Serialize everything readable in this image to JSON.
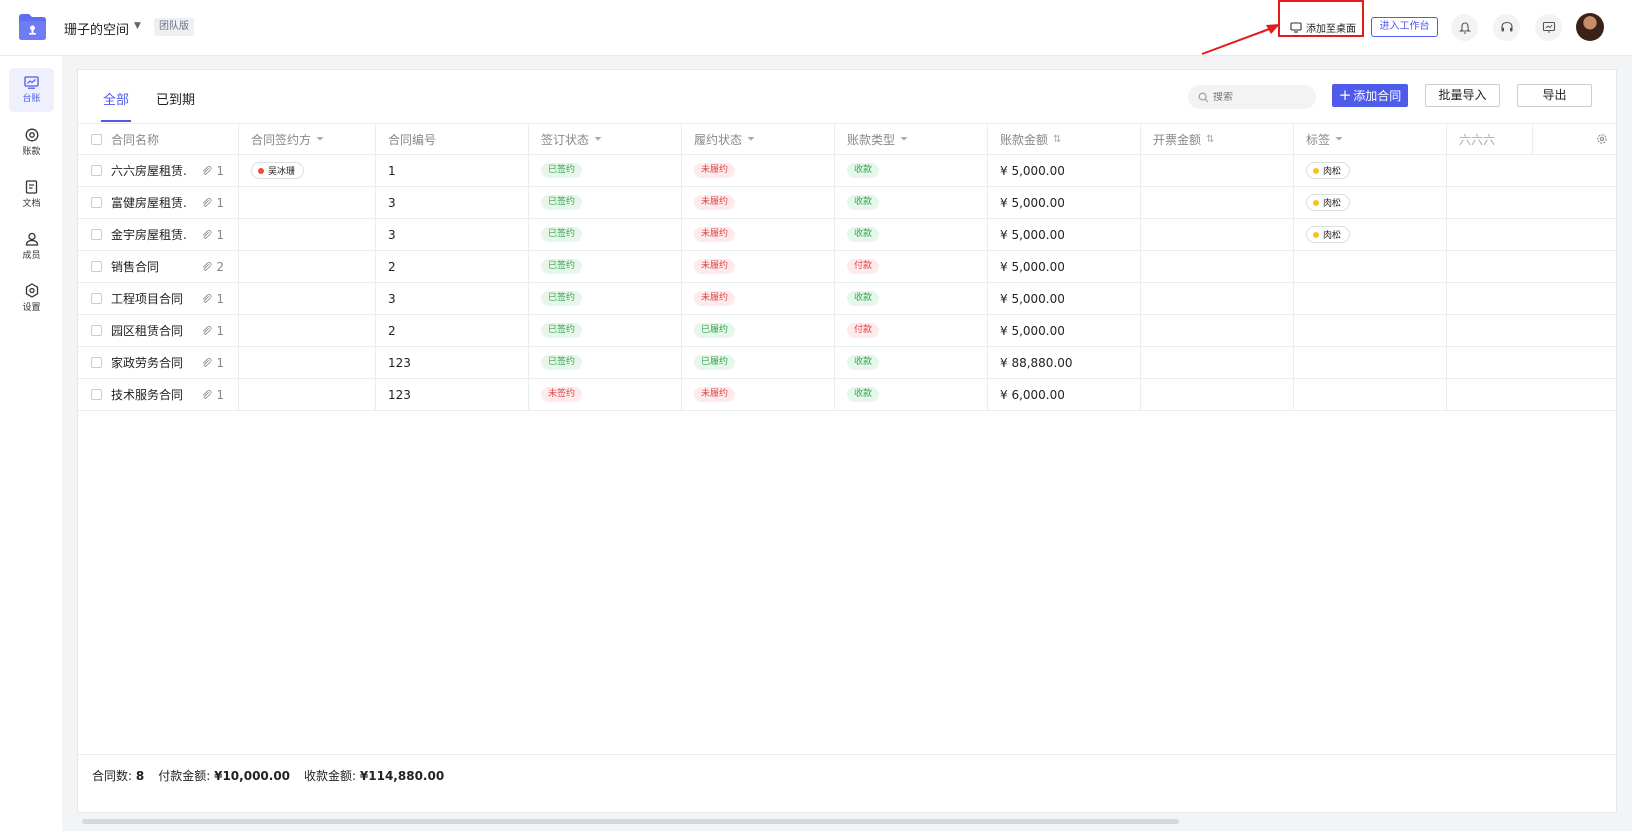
{
  "header": {
    "space_name": "珊子的空间",
    "edition": "团队版",
    "add_to_desktop": "添加至桌面",
    "enter_workbench": "进入工作台"
  },
  "sidebar": {
    "items": [
      {
        "label": "台账",
        "icon": "ledger-icon"
      },
      {
        "label": "账款",
        "icon": "payment-icon"
      },
      {
        "label": "文档",
        "icon": "document-icon"
      },
      {
        "label": "成员",
        "icon": "member-icon"
      },
      {
        "label": "设置",
        "icon": "settings-icon"
      }
    ]
  },
  "tabs": {
    "all": "全部",
    "expired": "已到期"
  },
  "toolbar": {
    "search_placeholder": "搜索",
    "add_contract": "添加合同",
    "batch_import": "批量导入",
    "export": "导出"
  },
  "table": {
    "columns": [
      "合同名称",
      "合同签约方",
      "合同编号",
      "签订状态",
      "履约状态",
      "账款类型",
      "账款金额",
      "开票金额",
      "标签",
      "六六六"
    ],
    "rows": [
      {
        "name": "六六房屋租赁...",
        "attach": "1",
        "party": "吴冰珊",
        "no": "1",
        "sign": "已签约",
        "perform": "未履约",
        "type": "收款",
        "amount": "¥ 5,000.00",
        "invoice": "",
        "tag": "肉松"
      },
      {
        "name": "富健房屋租赁...",
        "attach": "1",
        "party": "",
        "no": "3",
        "sign": "已签约",
        "perform": "未履约",
        "type": "收款",
        "amount": "¥ 5,000.00",
        "invoice": "",
        "tag": "肉松"
      },
      {
        "name": "金宇房屋租赁...",
        "attach": "1",
        "party": "",
        "no": "3",
        "sign": "已签约",
        "perform": "未履约",
        "type": "收款",
        "amount": "¥ 5,000.00",
        "invoice": "",
        "tag": "肉松"
      },
      {
        "name": "销售合同",
        "attach": "2",
        "party": "",
        "no": "2",
        "sign": "已签约",
        "perform": "未履约",
        "type": "付款",
        "amount": "¥ 5,000.00",
        "invoice": "",
        "tag": ""
      },
      {
        "name": "工程项目合同",
        "attach": "1",
        "party": "",
        "no": "3",
        "sign": "已签约",
        "perform": "未履约",
        "type": "收款",
        "amount": "¥ 5,000.00",
        "invoice": "",
        "tag": ""
      },
      {
        "name": "园区租赁合同",
        "attach": "1",
        "party": "",
        "no": "2",
        "sign": "已签约",
        "perform": "已履约",
        "type": "付款",
        "amount": "¥ 5,000.00",
        "invoice": "",
        "tag": ""
      },
      {
        "name": "家政劳务合同",
        "attach": "1",
        "party": "",
        "no": "123",
        "sign": "已签约",
        "perform": "已履约",
        "type": "收款",
        "amount": "¥ 88,880.00",
        "invoice": "",
        "tag": ""
      },
      {
        "name": "技术服务合同",
        "attach": "1",
        "party": "",
        "no": "123",
        "sign": "未签约",
        "perform": "未履约",
        "type": "收款",
        "amount": "¥ 6,000.00",
        "invoice": "",
        "tag": ""
      }
    ]
  },
  "footer": {
    "count_label": "合同数:",
    "count_value": "8",
    "pay_label": "付款金额:",
    "pay_value": "¥10,000.00",
    "receive_label": "收款金额:",
    "receive_value": "¥114,880.00"
  },
  "colors": {
    "accent": "#4f5bea",
    "green": "#37a64b",
    "red": "#e0484a",
    "annotation": "#e31b1b"
  }
}
